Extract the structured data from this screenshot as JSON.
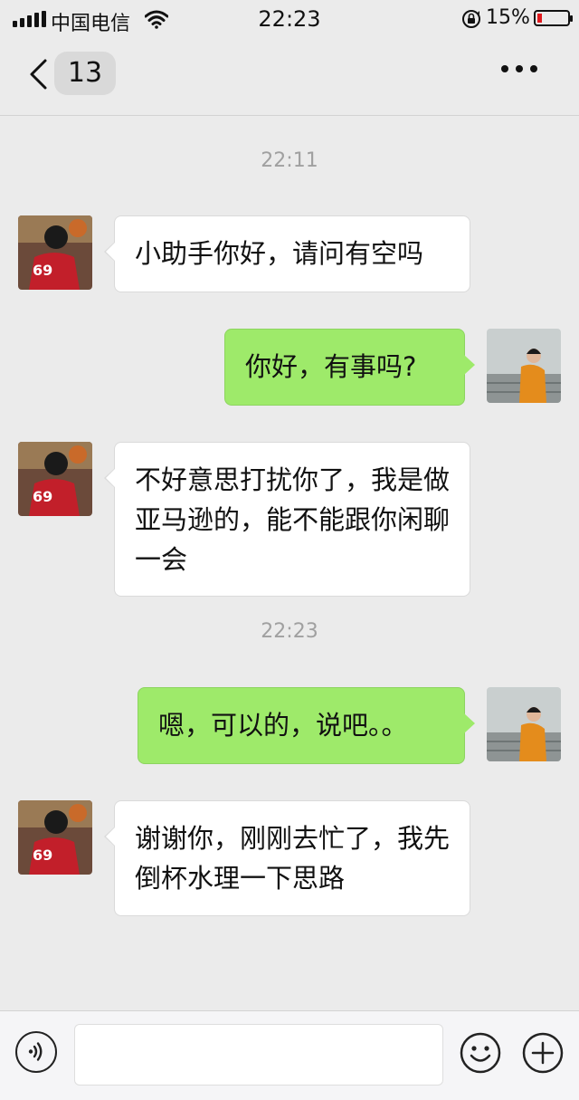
{
  "status_bar": {
    "carrier": "中国电信",
    "time": "22:23",
    "battery_percent": "15%",
    "battery_level": 0.15,
    "icons": [
      "signal-icon",
      "wifi-icon",
      "rotation-lock-icon",
      "battery-icon"
    ],
    "battery_color": "#e0191d"
  },
  "nav": {
    "back_icon": "chevron-left-icon",
    "unread_count": "13",
    "more_icon": "more-dots-icon"
  },
  "chat": {
    "timestamps": [
      "22:11",
      "22:23"
    ],
    "messages": [
      {
        "sender": "other",
        "text": "小助手你好，请问有空吗"
      },
      {
        "sender": "me",
        "text": "你好，有事吗?"
      },
      {
        "sender": "other",
        "text": "不好意思打扰你了，我是做亚马逊的，能不能跟你闲聊一会"
      },
      {
        "sender": "me",
        "text": "嗯，可以的，说吧。。"
      },
      {
        "sender": "other",
        "text": "谢谢你，刚刚去忙了，我先倒杯水理一下思路"
      }
    ],
    "colors": {
      "background": "#ebebeb",
      "incoming_bubble": "#ffffff",
      "outgoing_bubble": "#9eea6a",
      "timestamp_text": "#a0a0a0"
    }
  },
  "input_bar": {
    "voice_icon": "voice-icon",
    "input_value": "",
    "emoji_icon": "emoji-icon",
    "plus_icon": "plus-icon"
  }
}
